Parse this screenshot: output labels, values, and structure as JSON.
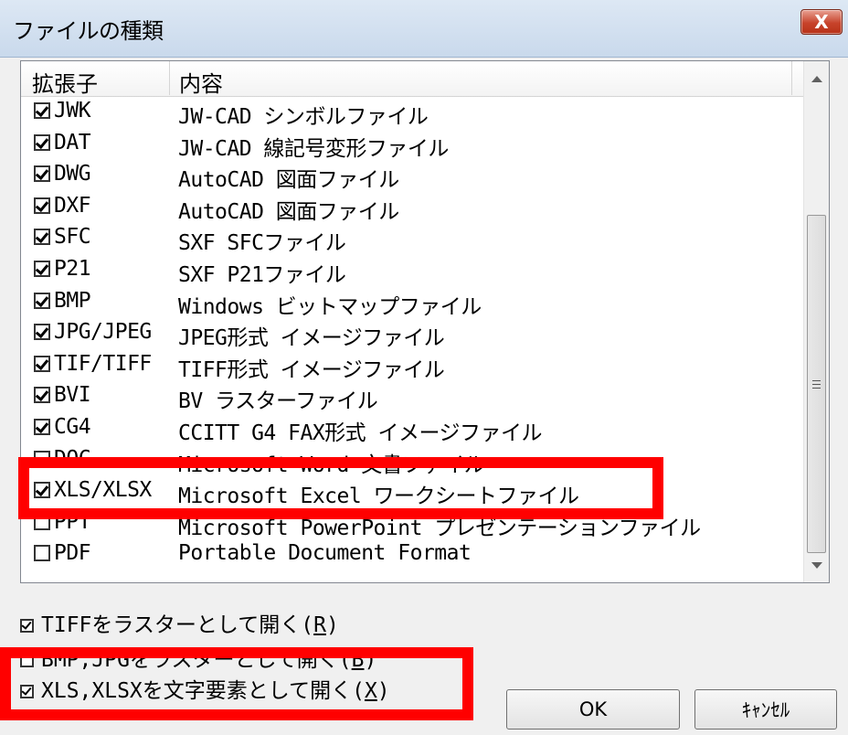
{
  "window": {
    "title": "ファイルの種類",
    "close_label": "X"
  },
  "list": {
    "columns": [
      "拡張子",
      "内容"
    ],
    "rows": [
      {
        "checked": true,
        "ext": "JWK",
        "desc": "JW-CAD シンボルファイル"
      },
      {
        "checked": true,
        "ext": "DAT",
        "desc": "JW-CAD 線記号変形ファイル"
      },
      {
        "checked": true,
        "ext": "DWG",
        "desc": "AutoCAD 図面ファイル"
      },
      {
        "checked": true,
        "ext": "DXF",
        "desc": "AutoCAD 図面ファイル"
      },
      {
        "checked": true,
        "ext": "SFC",
        "desc": "SXF SFCファイル"
      },
      {
        "checked": true,
        "ext": "P21",
        "desc": "SXF P21ファイル"
      },
      {
        "checked": true,
        "ext": "BMP",
        "desc": "Windows ビットマップファイル"
      },
      {
        "checked": true,
        "ext": "JPG/JPEG",
        "desc": "JPEG形式 イメージファイル"
      },
      {
        "checked": true,
        "ext": "TIF/TIFF",
        "desc": "TIFF形式 イメージファイル"
      },
      {
        "checked": true,
        "ext": "BVI",
        "desc": "BV ラスターファイル"
      },
      {
        "checked": true,
        "ext": "CG4",
        "desc": "CCITT G4 FAX形式 イメージファイル"
      },
      {
        "checked": false,
        "ext": "DOC",
        "desc": "Microsoft Word 文書ファイル"
      },
      {
        "checked": true,
        "ext": "XLS/XLSX",
        "desc": "Microsoft Excel ワークシートファイル"
      },
      {
        "checked": false,
        "ext": "PPT",
        "desc": "Microsoft PowerPoint プレゼンテーションファイル"
      },
      {
        "checked": false,
        "ext": "PDF",
        "desc": "Portable Document Format"
      }
    ]
  },
  "options": [
    {
      "checked": true,
      "label": "TIFFをラスターとして開く(",
      "mnemonic": "R",
      "suffix": ")"
    },
    {
      "checked": false,
      "label": "BMP,JPGをラスターとして開く(",
      "mnemonic": "B",
      "suffix": ")"
    },
    {
      "checked": true,
      "label": "XLS,XLSXを文字要素として開く(",
      "mnemonic": "X",
      "suffix": ")"
    }
  ],
  "buttons": {
    "ok": "OK",
    "cancel": "ｷｬﾝｾﾙ"
  },
  "colors": {
    "highlight": "#ff0000",
    "titlebar": "#c9d9ec",
    "close_button": "#c7432b"
  }
}
